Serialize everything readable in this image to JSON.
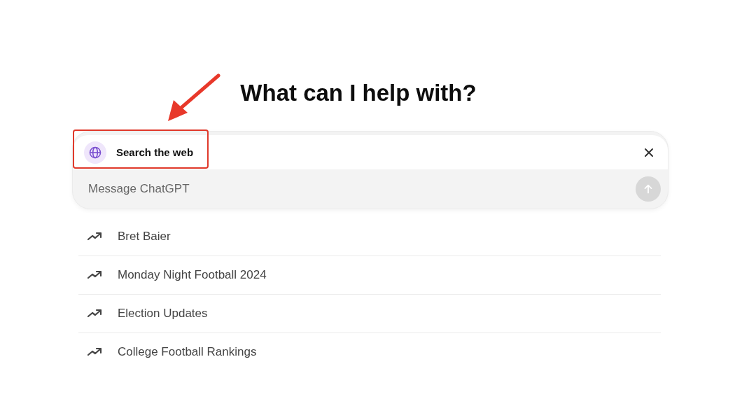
{
  "heading": "What can I help with?",
  "composer": {
    "tool": {
      "label": "Search the web",
      "selected": true
    },
    "placeholder": "Message ChatGPT",
    "send_disabled": true
  },
  "suggestions": [
    {
      "label": "Bret Baier"
    },
    {
      "label": "Monday Night Football 2024"
    },
    {
      "label": "Election Updates"
    },
    {
      "label": "College Football Rankings"
    }
  ]
}
